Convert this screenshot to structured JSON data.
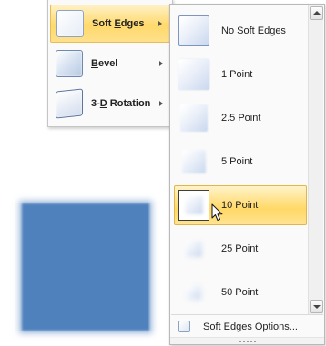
{
  "parent_menu": {
    "items": [
      {
        "pre": "Soft ",
        "key": "E",
        "post": "dges",
        "active": true
      },
      {
        "pre": "",
        "key": "B",
        "post": "evel",
        "active": false
      },
      {
        "pre": "3-",
        "key": "D",
        "post": " Rotation",
        "active": false
      }
    ]
  },
  "gallery": {
    "items": [
      {
        "label": "No Soft Edges"
      },
      {
        "label": "1 Point"
      },
      {
        "label": "2.5 Point"
      },
      {
        "label": "5 Point"
      },
      {
        "label": "10 Point",
        "hover": true
      },
      {
        "label": "25 Point"
      },
      {
        "label": "50 Point"
      }
    ],
    "footer": {
      "key": "S",
      "rest": "oft Edges Options..."
    }
  },
  "colors": {
    "shape_fill": "#4f81bd",
    "highlight": "#ffd96b"
  }
}
